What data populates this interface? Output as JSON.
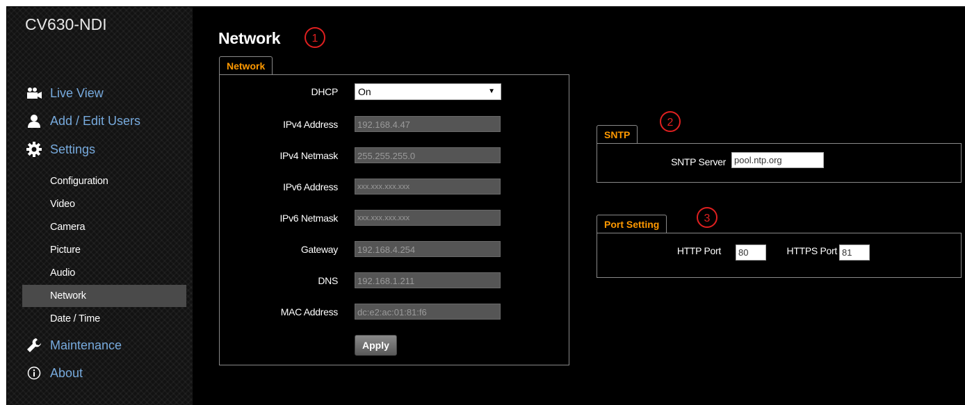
{
  "sidebar": {
    "brand": "CV630-NDI",
    "main_items": [
      {
        "label": "Live View",
        "icon": "camera-icon"
      },
      {
        "label": "Add / Edit Users",
        "icon": "user-icon"
      },
      {
        "label": "Settings",
        "icon": "gear-icon"
      },
      {
        "label": "Maintenance",
        "icon": "wrench-icon"
      },
      {
        "label": "About",
        "icon": "info-icon"
      }
    ],
    "settings_items": [
      {
        "label": "Configuration"
      },
      {
        "label": "Video"
      },
      {
        "label": "Camera"
      },
      {
        "label": "Picture"
      },
      {
        "label": "Audio"
      },
      {
        "label": "Network",
        "active": true
      },
      {
        "label": "Date / Time"
      }
    ]
  },
  "main": {
    "title": "Network",
    "markers": [
      "1",
      "2",
      "3"
    ],
    "network": {
      "tab_label": "Network",
      "dhcp": {
        "label": "DHCP",
        "value": "On",
        "arrow": "▼"
      },
      "fields": [
        {
          "label": "IPv4 Address",
          "value": "192.168.4.47"
        },
        {
          "label": "IPv4 Netmask",
          "value": "255.255.255.0"
        },
        {
          "label": "IPv6 Address",
          "value": "xxx.xxx.xxx.xxx"
        },
        {
          "label": "IPv6 Netmask",
          "value": "xxx.xxx.xxx.xxx"
        },
        {
          "label": "Gateway",
          "value": "192.168.4.254"
        },
        {
          "label": "DNS",
          "value": "192.168.1.211"
        },
        {
          "label": "MAC Address",
          "value": "dc:e2:ac:01:81:f6"
        }
      ],
      "apply_label": "Apply"
    },
    "sntp": {
      "tab_label": "SNTP",
      "server_label": "SNTP Server",
      "server_value": "pool.ntp.org"
    },
    "port": {
      "tab_label": "Port Setting",
      "http_label": "HTTP Port",
      "http_value": "80",
      "https_label": "HTTPS Port",
      "https_value": "81"
    }
  },
  "colors": {
    "tab_accent": "#ff9900",
    "nav_link": "#77aadd",
    "marker": "#e02020",
    "active_item_bg": "#4a4a4a"
  }
}
